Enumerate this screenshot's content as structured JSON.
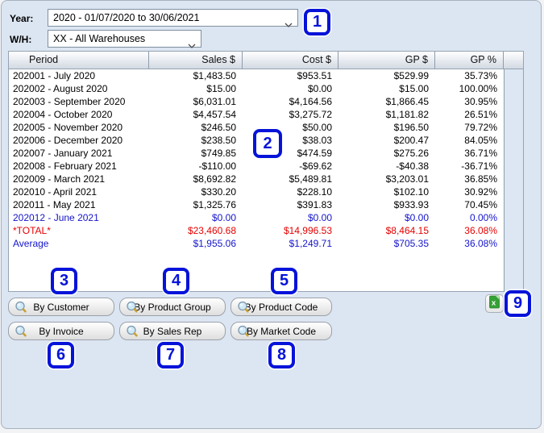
{
  "filters": {
    "year_label": "Year:",
    "year_value": "2020 - 01/07/2020 to 30/06/2021",
    "wh_label": "W/H:",
    "wh_value": "XX - All Warehouses"
  },
  "table": {
    "columns": [
      "Period",
      "Sales $",
      "Cost $",
      "GP $",
      "GP %"
    ],
    "rows": [
      {
        "period": "202001 - July 2020",
        "sales": "$1,483.50",
        "cost": "$953.51",
        "gp": "$529.99",
        "gp_pct": "35.73%",
        "style": "normal"
      },
      {
        "period": "202002 - August 2020",
        "sales": "$15.00",
        "cost": "$0.00",
        "gp": "$15.00",
        "gp_pct": "100.00%",
        "style": "normal"
      },
      {
        "period": "202003 - September 2020",
        "sales": "$6,031.01",
        "cost": "$4,164.56",
        "gp": "$1,866.45",
        "gp_pct": "30.95%",
        "style": "normal"
      },
      {
        "period": "202004 - October 2020",
        "sales": "$4,457.54",
        "cost": "$3,275.72",
        "gp": "$1,181.82",
        "gp_pct": "26.51%",
        "style": "normal"
      },
      {
        "period": "202005 - November 2020",
        "sales": "$246.50",
        "cost": "$50.00",
        "gp": "$196.50",
        "gp_pct": "79.72%",
        "style": "normal"
      },
      {
        "period": "202006 - December 2020",
        "sales": "$238.50",
        "cost": "$38.03",
        "gp": "$200.47",
        "gp_pct": "84.05%",
        "style": "normal"
      },
      {
        "period": "202007 - January 2021",
        "sales": "$749.85",
        "cost": "$474.59",
        "gp": "$275.26",
        "gp_pct": "36.71%",
        "style": "normal"
      },
      {
        "period": "202008 - February 2021",
        "sales": "-$110.00",
        "cost": "-$69.62",
        "gp": "-$40.38",
        "gp_pct": "-36.71%",
        "style": "normal"
      },
      {
        "period": "202009 - March 2021",
        "sales": "$8,692.82",
        "cost": "$5,489.81",
        "gp": "$3,203.01",
        "gp_pct": "36.85%",
        "style": "normal"
      },
      {
        "period": "202010 - April 2021",
        "sales": "$330.20",
        "cost": "$228.10",
        "gp": "$102.10",
        "gp_pct": "30.92%",
        "style": "normal"
      },
      {
        "period": "202011 - May 2021",
        "sales": "$1,325.76",
        "cost": "$391.83",
        "gp": "$933.93",
        "gp_pct": "70.45%",
        "style": "normal"
      },
      {
        "period": "202012 - June 2021",
        "sales": "$0.00",
        "cost": "$0.00",
        "gp": "$0.00",
        "gp_pct": "0.00%",
        "style": "blue"
      },
      {
        "period": "*TOTAL*",
        "sales": "$23,460.68",
        "cost": "$14,996.53",
        "gp": "$8,464.15",
        "gp_pct": "36.08%",
        "style": "red"
      },
      {
        "period": "Average",
        "sales": "$1,955.06",
        "cost": "$1,249.71",
        "gp": "$705.35",
        "gp_pct": "36.08%",
        "style": "blue"
      }
    ]
  },
  "buttons": [
    {
      "label": "By Customer"
    },
    {
      "label": "By Product Group"
    },
    {
      "label": "By Product Code"
    },
    {
      "label": "By Invoice"
    },
    {
      "label": "By Sales Rep"
    },
    {
      "label": "By Market Code"
    }
  ],
  "export": {
    "icon": "excel-export-icon"
  },
  "annotations": [
    "1",
    "2",
    "3",
    "4",
    "5",
    "6",
    "7",
    "8",
    "9"
  ],
  "colors": {
    "panel_bg": "#dce6f2",
    "row_blue": "#1414cc",
    "row_red": "#e60000",
    "annotation_blue": "#0513d9",
    "excel_green": "#35a135"
  }
}
